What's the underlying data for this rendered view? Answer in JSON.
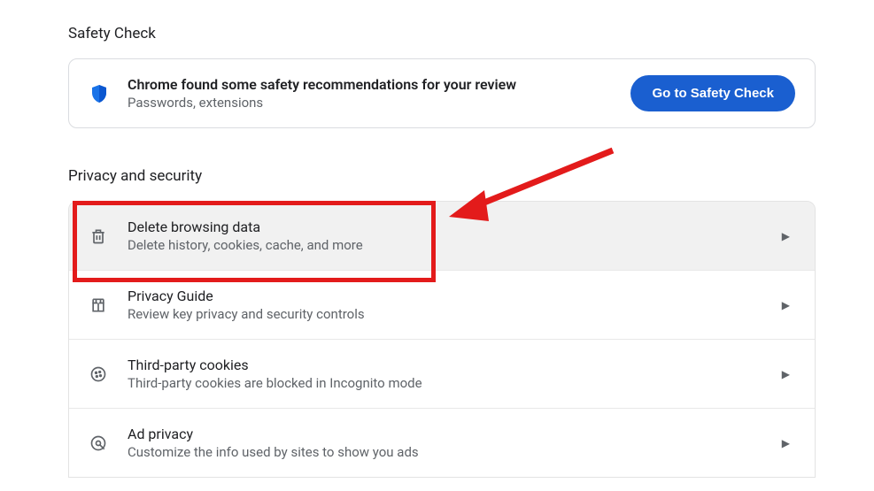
{
  "safety": {
    "section_title": "Safety Check",
    "title": "Chrome found some safety recommendations for your review",
    "subtitle": "Passwords, extensions",
    "button_label": "Go to Safety Check"
  },
  "privacy": {
    "section_title": "Privacy and security",
    "items": [
      {
        "title": "Delete browsing data",
        "subtitle": "Delete history, cookies, cache, and more"
      },
      {
        "title": "Privacy Guide",
        "subtitle": "Review key privacy and security controls"
      },
      {
        "title": "Third-party cookies",
        "subtitle": "Third-party cookies are blocked in Incognito mode"
      },
      {
        "title": "Ad privacy",
        "subtitle": "Customize the info used by sites to show you ads"
      }
    ]
  },
  "annotation": {
    "color": "#e31b1b"
  }
}
